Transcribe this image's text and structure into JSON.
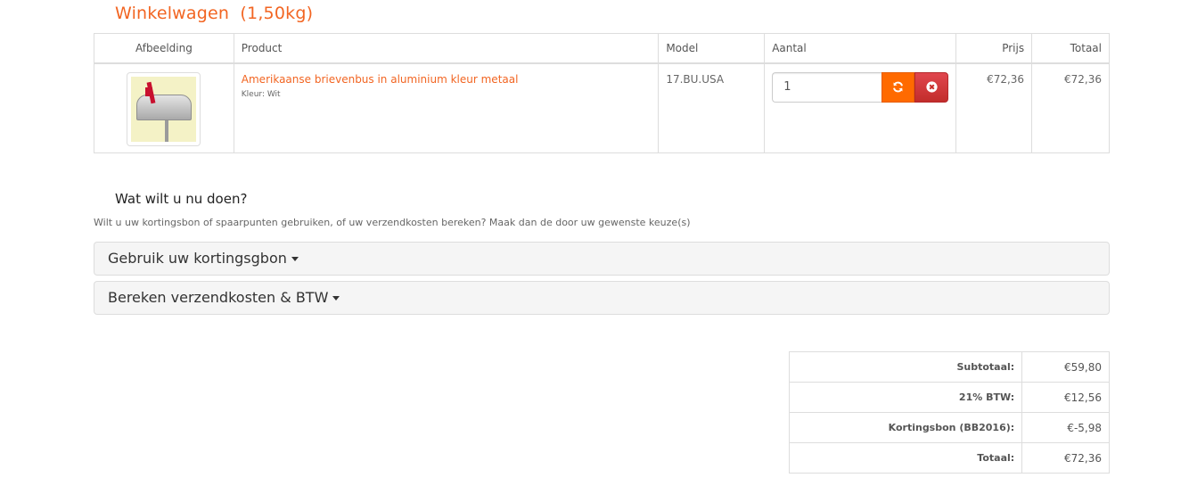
{
  "page": {
    "title": "Winkelwagen",
    "weight": "(1,50kg)"
  },
  "cart": {
    "columns": {
      "image": "Afbeelding",
      "product": "Product",
      "model": "Model",
      "quantity": "Aantal",
      "price": "Prijs",
      "total": "Totaal"
    },
    "items": [
      {
        "image_icon": "mailbox-product-image",
        "name": "Amerikaanse brievenbus in aluminium kleur metaal",
        "option": "Kleur: Wit",
        "model": "17.BU.USA",
        "quantity": "1",
        "price": "€72,36",
        "total": "€72,36"
      }
    ]
  },
  "next": {
    "title": "Wat wilt u nu doen?",
    "description": "Wilt u uw kortingsbon of spaarpunten gebruiken, of uw verzendkosten bereken? Maak dan de door uw gewenste keuze(s)",
    "panels": [
      {
        "label": "Gebruik uw kortingsgbon"
      },
      {
        "label": "Bereken verzendkosten & BTW"
      }
    ]
  },
  "totals": [
    {
      "label": "Subtotaal:",
      "value": "€59,80"
    },
    {
      "label": "21% BTW:",
      "value": "€12,56"
    },
    {
      "label": "Kortingsbon (BB2016):",
      "value": "€-5,98"
    },
    {
      "label": "Totaal:",
      "value": "€72,36"
    }
  ],
  "colors": {
    "accent": "#f26522",
    "update_button": "#ff6a00",
    "remove_button": "#d9534f"
  }
}
